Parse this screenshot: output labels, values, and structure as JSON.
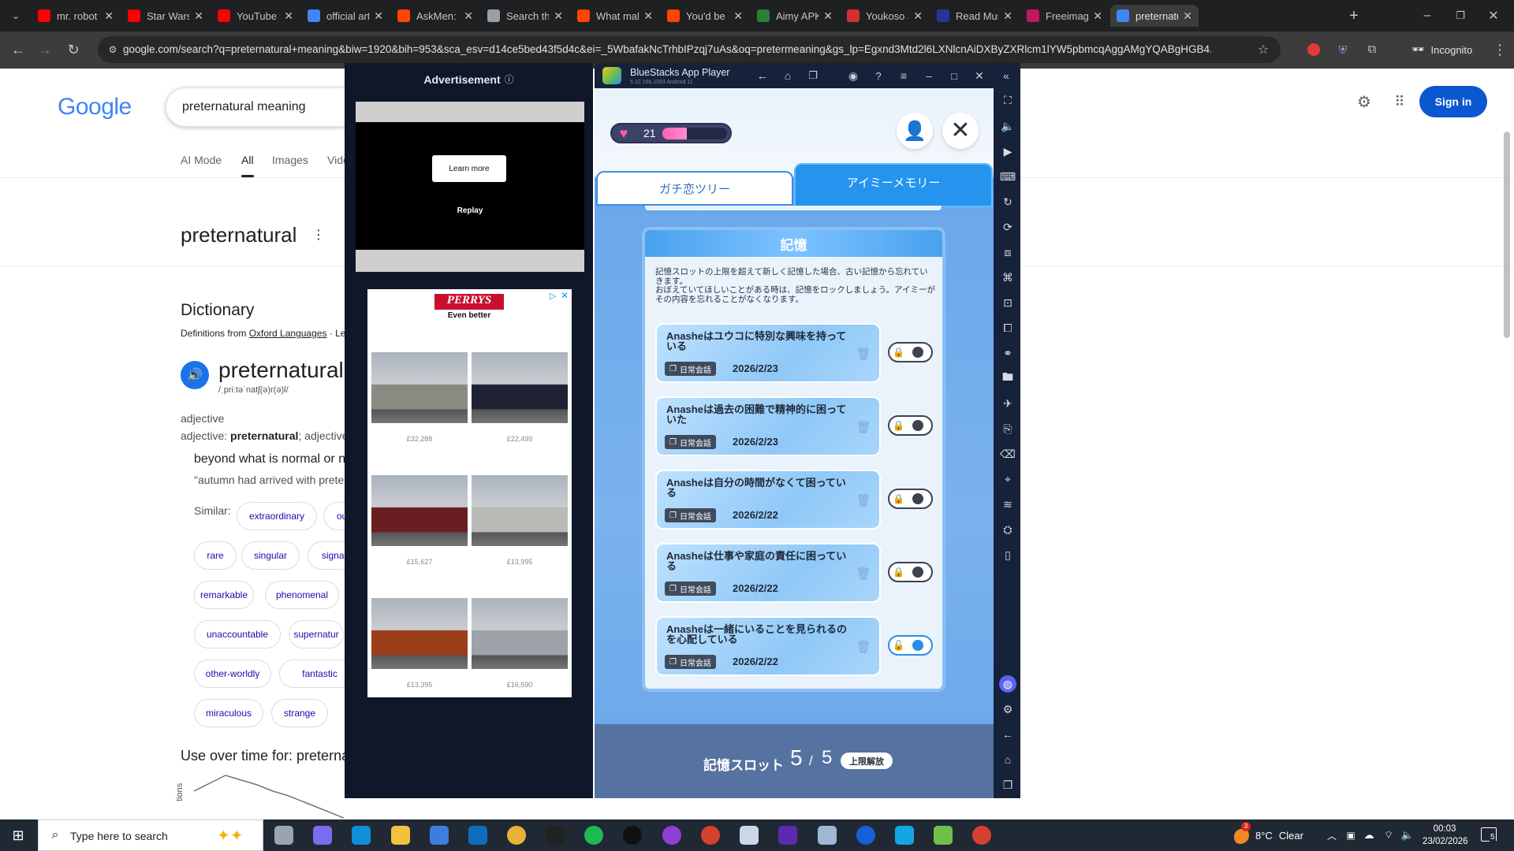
{
  "browser": {
    "tabs": [
      {
        "title": "mr. robot v",
        "icon": "youtube-icon",
        "color": "#ff0000"
      },
      {
        "title": "Star Wars I",
        "icon": "youtube-icon",
        "color": "#ff0000"
      },
      {
        "title": "YouTube",
        "icon": "youtube-icon",
        "color": "#ff0000"
      },
      {
        "title": "official art,",
        "icon": "google-icon",
        "color": "#4285f4"
      },
      {
        "title": "AskMen: a",
        "icon": "reddit-icon",
        "color": "#ff4500"
      },
      {
        "title": "Search thr",
        "icon": "document-icon",
        "color": "#9aa0a6"
      },
      {
        "title": "What make",
        "icon": "reddit-icon",
        "color": "#ff4500"
      },
      {
        "title": "You'd be s",
        "icon": "reddit-icon",
        "color": "#ff4500"
      },
      {
        "title": "Aimy APK",
        "icon": "apk-icon",
        "color": "#2e7d32"
      },
      {
        "title": "Youkoso Ji",
        "icon": "site-icon",
        "color": "#d32f2f"
      },
      {
        "title": "Read Musi",
        "icon": "manga-icon",
        "color": "#283593"
      },
      {
        "title": "Freeimage",
        "icon": "image-icon",
        "color": "#c2185b"
      },
      {
        "title": "preternatu",
        "icon": "google-icon",
        "color": "#4285f4",
        "active": true
      }
    ],
    "url": "google.com/search?q=preternatural+meaning&biw=1920&bih=953&sca_esv=d14ce5bed43f5d4c&ei=_5WbafakNcTrhbIPzqj7uAs&oq=pretermeaning&gs_lp=Egxnd3Mtd2l6LXNlcnAiDXByZXRlcm1lYW5pbmcqAggAMgYQABgHGB4...",
    "incognito": "Incognito"
  },
  "google": {
    "logo": "Google",
    "query": "preternatural meaning",
    "tabs": [
      "AI Mode",
      "All",
      "Images",
      "Vide"
    ],
    "active_tab": "All",
    "sign_in": "Sign in",
    "heading": "preternatural",
    "dictionary": {
      "title": "Dictionary",
      "source_prefix": "Definitions from ",
      "source": "Oxford Languages",
      "source_suffix": " · Le",
      "word": "preternatural",
      "phonetic": "/ˌpriːtəˈnatʃ(ə)r(ə)l/",
      "pos": "adjective",
      "pos_line_prefix": "adjective: ",
      "pos_line_word": "preternatural",
      "pos_line_suffix": "; adjective",
      "definition": "beyond what is normal or n",
      "example": "\"autumn had arrived with prete",
      "similar_label": "Similar:",
      "similar": [
        "extraordinary",
        "ou",
        "rare",
        "singular",
        "signal",
        "remarkable",
        "phenomenal",
        "unaccountable",
        "supernatur",
        "other-worldly",
        "fantastic",
        "miraculous",
        "strange"
      ]
    },
    "use_over_time": "Use over time for: preterna",
    "chart_axis_label": "tions"
  },
  "ad": {
    "label": "Advertisement",
    "learn_more": "Learn more",
    "replay": "Replay",
    "brand": "PERRYS",
    "tagline": "Even better",
    "cars": [
      {
        "price": "£32,288",
        "color": "#8a8a82"
      },
      {
        "price": "£22,499",
        "color": "#1e2233"
      },
      {
        "price": "£15,627",
        "color": "#6b1e22"
      },
      {
        "price": "£13,995",
        "color": "#b8bab6"
      },
      {
        "price": "£13,395",
        "color": "#9a3e1a"
      },
      {
        "price": "£16,590",
        "color": "#9da2a8"
      }
    ]
  },
  "bluestacks": {
    "title": "BlueStacks App Player",
    "version": "5.22.166.1003  Android 11"
  },
  "game": {
    "hearts": "21",
    "tab_left": "ガチ恋ツリー",
    "tab_right": "アイミーメモリー",
    "panel_title": "記憶",
    "description": "記憶スロットの上限を超えて新しく記憶した場合、古い記憶から忘れていきます。\nおぼえていてほしいことがある時は、記憶をロックしましょう。アイミーがその内容を忘れることがなくなります。",
    "memories": [
      {
        "text": "Anasheはユウコに特別な興味を持っている",
        "tag": "日常会話",
        "date": "2026/2/23",
        "locked": false
      },
      {
        "text": "Anasheは過去の困難で精神的に困っていた",
        "tag": "日常会話",
        "date": "2026/2/23",
        "locked": false
      },
      {
        "text": "Anasheは自分の時間がなくて困っている",
        "tag": "日常会話",
        "date": "2026/2/22",
        "locked": false
      },
      {
        "text": "Anasheは仕事や家庭の責任に困っている",
        "tag": "日常会話",
        "date": "2026/2/22",
        "locked": false
      },
      {
        "text": "Anasheは一緒にいることを見られるのを心配している",
        "tag": "日常会話",
        "date": "2026/2/22",
        "locked": true
      }
    ],
    "slot_label": "記憶スロット",
    "slot_used": "5",
    "slot_sep": "/",
    "slot_total": "5",
    "slot_button": "上限解放"
  },
  "taskbar": {
    "search_placeholder": "Type here to search",
    "weather_temp": "8°C",
    "weather_text": "Clear",
    "weather_badge": "3",
    "time": "00:03",
    "date": "23/02/2026",
    "notification_count": "5"
  }
}
